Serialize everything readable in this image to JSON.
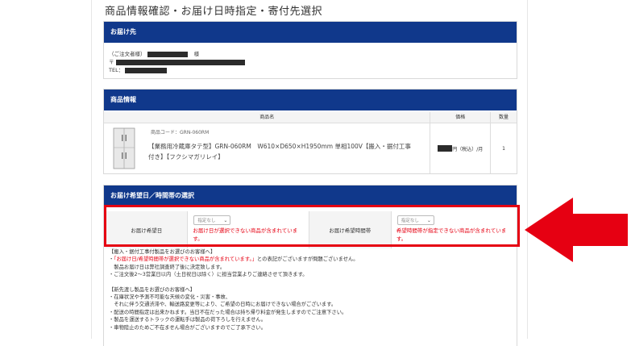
{
  "page_title": "商品情報確認・お届け日時指定・寄付先選択",
  "delivery_address": {
    "heading": "お届け先",
    "name_label": "（ご注文者様）",
    "name_suffix": "様",
    "postal_label": "〒",
    "tel_label": "TEL："
  },
  "product_info": {
    "heading": "商品情報",
    "columns": [
      "商品名",
      "価格",
      "数量"
    ],
    "item": {
      "code": "商品コード：GRN-060RM",
      "name": "【業務用冷蔵庫タテ型】GRN-060RM　W610×D650×H1950mm 単相100V【搬入・据付工事付き】【フクシマガリレイ】",
      "price_suffix": "円（税込）/月",
      "quantity": "1"
    }
  },
  "delivery_datetime": {
    "heading": "お届け希望日／時間帯の選択",
    "date_label": "お届け希望日",
    "date_select": "指定なし",
    "date_error": "お届け日が選択できない商品が含まれています。",
    "time_label": "お届け希望時間帯",
    "time_select": "指定なし",
    "time_error": "希望時間帯が指定できない商品が含まれています。"
  },
  "notes": {
    "l1": "【搬入・据付工事付製品をお選びのお客様へ】",
    "l2_pre": "・",
    "l2_red": "「お届け日/希望時間帯が選択できない商品が含まれています。」",
    "l2_post": "との表記がございますが問題ございません。",
    "l3": "　製品お届け日は弊社調査終了後に決定致します。",
    "l4": "・ご注文後2～3営業日以内（土日祝日は除く）に担当営業よりご連絡させて頂きます。",
    "l5": "",
    "l6": "【新先渡し製品をお選びのお客様へ】",
    "l7": "・在庫状況や予測不可能な天候の変化・災害・事故、",
    "l8": "　それに伴う交通渋滞や、輸送路変更等により、ご希望の日時にお届けできない場合がございます。",
    "l9": "・配送の時間指定は出来かねます。当日不在だった場合は持ち帰り料金が発生しますのでご注意下さい。",
    "l10": "・製品を運送するトラックの運転手は製品の荷下ろしを行えません。",
    "l11": "・車物陸止のためご不在ません場合がございますのでご了承下さい。"
  },
  "colors": {
    "header_bg": "#10388b",
    "error_red": "#e60012",
    "highlight_red": "#e60012"
  }
}
